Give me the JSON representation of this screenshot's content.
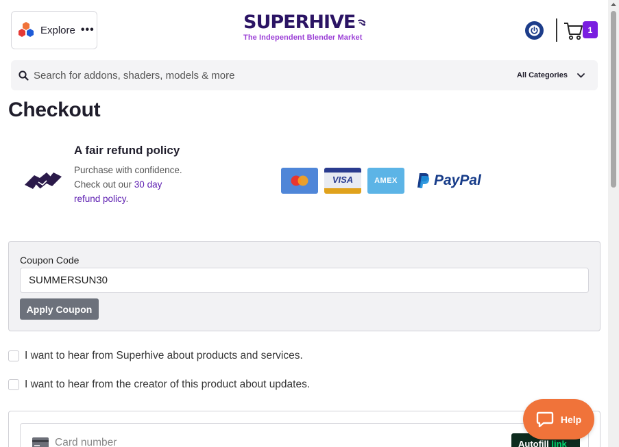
{
  "header": {
    "explore_label": "Explore",
    "explore_more": "•••",
    "logo_brand": "SUPERHIVE",
    "logo_tagline": "The Independent Blender Market",
    "cart_count": "1"
  },
  "search": {
    "placeholder": "Search for addons, shaders, models & more",
    "category_selected": "All Categories"
  },
  "page": {
    "title": "Checkout"
  },
  "refund": {
    "title": "A fair refund policy",
    "text_line1": "Purchase with confidence.",
    "text_line2": "Check out our ",
    "link_text": "30 day refund policy",
    "text_end": "."
  },
  "payment_methods": {
    "visa": "VISA",
    "amex": "AMEX",
    "paypal": "PayPal"
  },
  "coupon": {
    "label": "Coupon Code",
    "value": "SUMMERSUN30",
    "apply_label": "Apply Coupon"
  },
  "consent": {
    "superhive": "I want to hear from Superhive about products and services.",
    "creator": "I want to hear from the creator of this product about updates."
  },
  "card": {
    "placeholder": "Card number",
    "autofill_label": "Autofill",
    "autofill_link": "link"
  },
  "help": {
    "label": "Help"
  },
  "colors": {
    "brand": "#2b1464",
    "accent_purple": "#7a1fe0",
    "help_orange": "#f0733a",
    "link_purple": "#5b1bb0"
  }
}
